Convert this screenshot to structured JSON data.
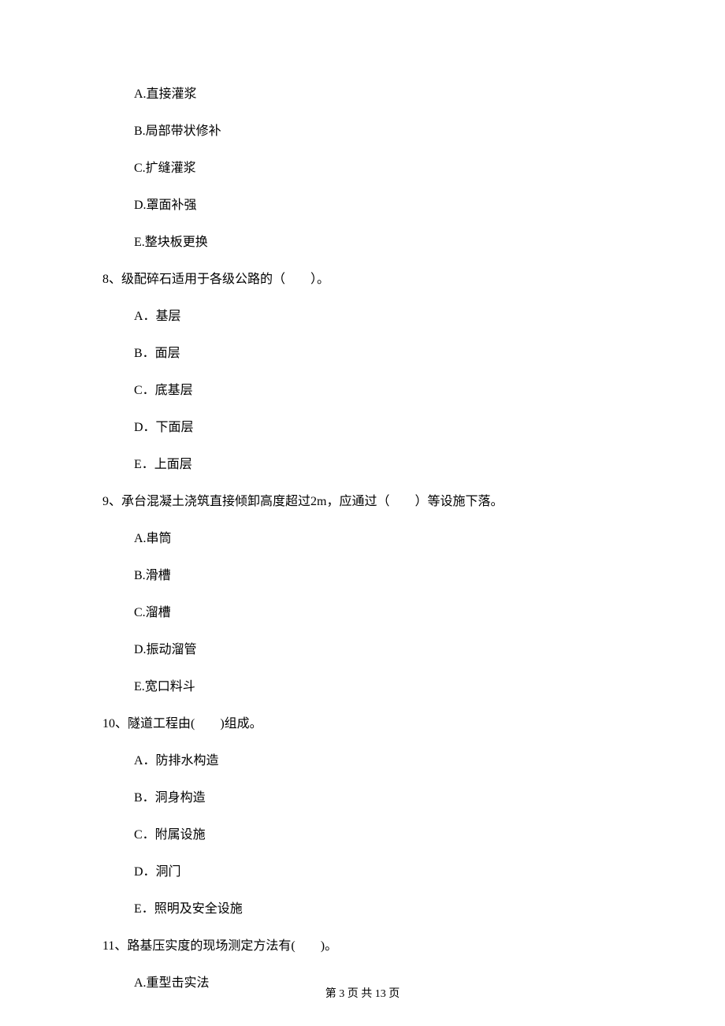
{
  "q7_options": {
    "a": "A.直接灌浆",
    "b": "B.局部带状修补",
    "c": "C.扩缝灌浆",
    "d": "D.罩面补强",
    "e": "E.整块板更换"
  },
  "q8": {
    "stem": "8、级配碎石适用于各级公路的（　　）。",
    "a": "A．基层",
    "b": "B．面层",
    "c": "C．底基层",
    "d": "D．下面层",
    "e": "E．上面层"
  },
  "q9": {
    "stem": "9、承台混凝土浇筑直接倾卸高度超过2m，应通过（　　）等设施下落。",
    "a": "A.串筒",
    "b": "B.滑槽",
    "c": "C.溜槽",
    "d": "D.振动溜管",
    "e": "E.宽口料斗"
  },
  "q10": {
    "stem": "10、隧道工程由(　　)组成。",
    "a": "A．防排水构造",
    "b": "B．洞身构造",
    "c": "C．附属设施",
    "d": "D．洞门",
    "e": "E．照明及安全设施"
  },
  "q11": {
    "stem": "11、路基压实度的现场测定方法有(　　)。",
    "a": "A.重型击实法"
  },
  "footer": "第 3 页 共 13 页"
}
